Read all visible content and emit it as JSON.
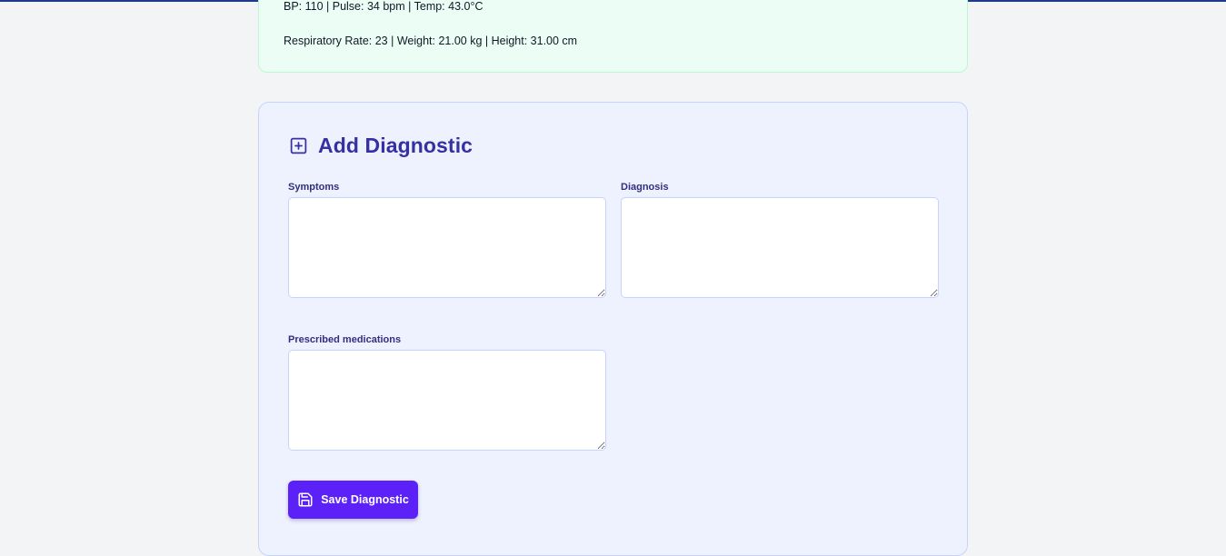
{
  "vitals": {
    "line1": "BP: 110 | Pulse: 34 bpm | Temp: 43.0°C",
    "line2": "Respiratory Rate: 23 | Weight: 21.00 kg | Height: 31.00 cm"
  },
  "diagnostic": {
    "title": "Add Diagnostic",
    "title_icon": "plus-square-icon",
    "fields": {
      "symptoms": {
        "label": "Symptoms",
        "value": "",
        "placeholder": ""
      },
      "diagnosis": {
        "label": "Diagnosis",
        "value": "",
        "placeholder": ""
      },
      "medications": {
        "label": "Prescribed medications",
        "value": "",
        "placeholder": ""
      }
    },
    "save_button": {
      "label": "Save Diagnostic",
      "icon": "save-icon"
    }
  },
  "colors": {
    "accent": "#5b21f6",
    "title": "#3730a3",
    "vitals_bg": "#ecfdf5",
    "form_bg": "#eef2ff"
  }
}
